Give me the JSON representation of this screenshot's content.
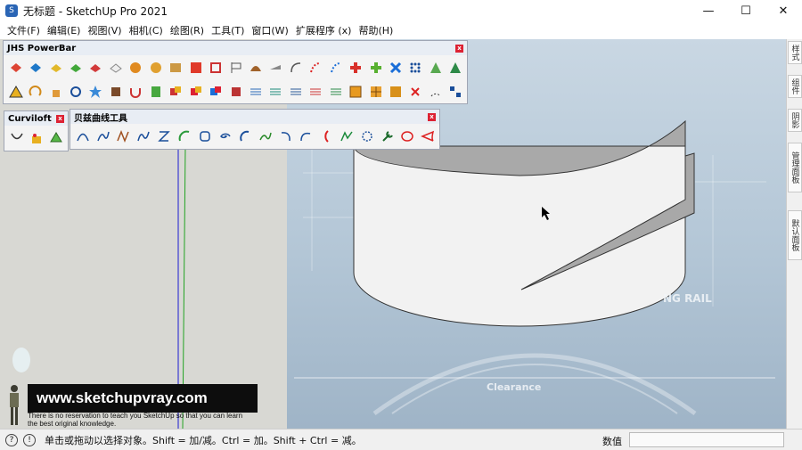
{
  "window": {
    "title": "无标题 - SketchUp Pro 2021",
    "minimize": "—",
    "maximize": "☐",
    "close": "✕"
  },
  "menu": [
    "文件(F)",
    "编辑(E)",
    "视图(V)",
    "相机(C)",
    "绘图(R)",
    "工具(T)",
    "窗口(W)",
    "扩展程序 (x)",
    "帮助(H)"
  ],
  "panels": {
    "powerbar": {
      "title": "JHS PowerBar",
      "close": "x"
    },
    "curviloft": {
      "title": "Curviloft",
      "close": "x"
    },
    "bezier": {
      "title": "贝兹曲线工具",
      "close": "x"
    }
  },
  "right_tray": [
    "样式",
    "组件",
    "阴影",
    "管理面板",
    "默认面板"
  ],
  "background_text": {
    "rail": "NG RAIL",
    "clearance": "Clearance"
  },
  "watermark": {
    "url": "www.sketchupvray.com",
    "line1": "There is no reservation to teach you SketchUp so that you can learn",
    "line2": "the best original knowledge."
  },
  "status": {
    "hint": "单击或拖动以选择对象。Shift = 加/减。Ctrl = 加。Shift + Ctrl = 减。",
    "measure_label": "数值",
    "measure_value": ""
  },
  "colors": {
    "accent": "#2a65b5",
    "panel_title": "#e8edf4",
    "sky": "#b3c6d6"
  }
}
